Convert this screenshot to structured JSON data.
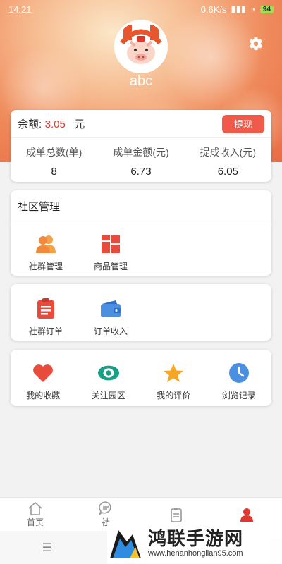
{
  "status_bar": {
    "time": "14:21",
    "network_speed": "0.6K/s",
    "battery": "94"
  },
  "profile": {
    "username": "abc"
  },
  "balance": {
    "label": "余额:",
    "value": "3.05",
    "unit": "元",
    "withdraw_label": "提现"
  },
  "stats": [
    {
      "label": "成单总数(单)",
      "value": "8"
    },
    {
      "label": "成单金额(元)",
      "value": "6.73"
    },
    {
      "label": "提成收入(元)",
      "value": "6.05"
    }
  ],
  "community": {
    "title": "社区管理",
    "items": [
      {
        "label": "社群管理",
        "icon": "users-icon"
      },
      {
        "label": "商品管理",
        "icon": "grid-icon"
      }
    ]
  },
  "orders": {
    "items": [
      {
        "label": "社群订单",
        "icon": "clipboard-icon"
      },
      {
        "label": "订单收入",
        "icon": "wallet-icon"
      }
    ]
  },
  "shortcuts": {
    "items": [
      {
        "label": "我的收藏",
        "icon": "heart-icon"
      },
      {
        "label": "关注园区",
        "icon": "eye-icon"
      },
      {
        "label": "我的评价",
        "icon": "star-icon"
      },
      {
        "label": "浏览记录",
        "icon": "clock-icon"
      }
    ]
  },
  "tabbar": {
    "items": [
      {
        "label": "首页",
        "icon": "home-icon"
      },
      {
        "label": "社",
        "icon": "chat-icon"
      },
      {
        "label": "",
        "icon": "clipboard-icon"
      },
      {
        "label": "",
        "icon": "user-icon"
      }
    ]
  },
  "watermark": {
    "title": "鸿联手游网",
    "url": "www.henanhonglian95.com"
  },
  "colors": {
    "accent": "#e2372f",
    "button": "#f05a4b",
    "orange": "#f08a3a",
    "blue": "#4a8fe0",
    "teal": "#16a085"
  }
}
